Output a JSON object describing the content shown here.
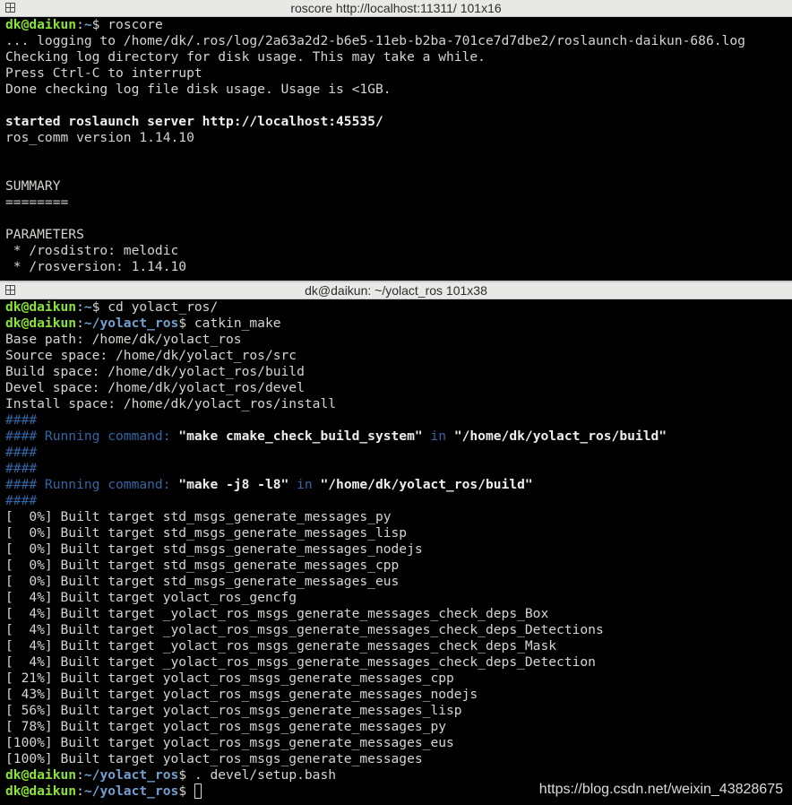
{
  "top_window": {
    "title": "roscore http://localhost:11311/ 101x16",
    "prompt": {
      "user": "dk@daikun",
      "path": "~",
      "cmd": "roscore"
    },
    "lines": [
      "... logging to /home/dk/.ros/log/2a63a2d2-b6e5-11eb-b2ba-701ce7d7dbe2/roslaunch-daikun-686.log",
      "Checking log directory for disk usage. This may take a while.",
      "Press Ctrl-C to interrupt",
      "Done checking log file disk usage. Usage is <1GB.",
      "",
      "started roslaunch server http://localhost:45535/",
      "ros_comm version 1.14.10",
      "",
      "",
      "SUMMARY",
      "========",
      "",
      "PARAMETERS",
      " * /rosdistro: melodic",
      " * /rosversion: 1.14.10"
    ]
  },
  "bottom_window": {
    "title": "dk@daikun: ~/yolact_ros 101x38",
    "prompt1": {
      "user": "dk@daikun",
      "path": "~",
      "cmd": "cd yolact_ros/"
    },
    "prompt2": {
      "user": "dk@daikun",
      "path": "~/yolact_ros",
      "cmd": "catkin_make"
    },
    "info_lines": [
      "Base path: /home/dk/yolact_ros",
      "Source space: /home/dk/yolact_ros/src",
      "Build space: /home/dk/yolact_ros/build",
      "Devel space: /home/dk/yolact_ros/devel",
      "Install space: /home/dk/yolact_ros/install"
    ],
    "hash": "####",
    "run1": {
      "prefix": "#### Running command: ",
      "cmd": "\"make cmake_check_build_system\"",
      "in": " in ",
      "dir": "\"/home/dk/yolact_ros/build\""
    },
    "run2": {
      "prefix": "#### Running command: ",
      "cmd": "\"make -j8 -l8\"",
      "in": " in ",
      "dir": "\"/home/dk/yolact_ros/build\""
    },
    "build_lines": [
      "[  0%] Built target std_msgs_generate_messages_py",
      "[  0%] Built target std_msgs_generate_messages_lisp",
      "[  0%] Built target std_msgs_generate_messages_nodejs",
      "[  0%] Built target std_msgs_generate_messages_cpp",
      "[  0%] Built target std_msgs_generate_messages_eus",
      "[  4%] Built target yolact_ros_gencfg",
      "[  4%] Built target _yolact_ros_msgs_generate_messages_check_deps_Box",
      "[  4%] Built target _yolact_ros_msgs_generate_messages_check_deps_Detections",
      "[  4%] Built target _yolact_ros_msgs_generate_messages_check_deps_Mask",
      "[  4%] Built target _yolact_ros_msgs_generate_messages_check_deps_Detection",
      "[ 21%] Built target yolact_ros_msgs_generate_messages_cpp",
      "[ 43%] Built target yolact_ros_msgs_generate_messages_nodejs",
      "[ 56%] Built target yolact_ros_msgs_generate_messages_lisp",
      "[ 78%] Built target yolact_ros_msgs_generate_messages_py",
      "[100%] Built target yolact_ros_msgs_generate_messages_eus",
      "[100%] Built target yolact_ros_msgs_generate_messages"
    ],
    "prompt3": {
      "user": "dk@daikun",
      "path": "~/yolact_ros",
      "cmd": ". devel/setup.bash"
    },
    "prompt4": {
      "user": "dk@daikun",
      "path": "~/yolact_ros",
      "cmd": ""
    }
  },
  "watermark": "https://blog.csdn.net/weixin_43828675"
}
